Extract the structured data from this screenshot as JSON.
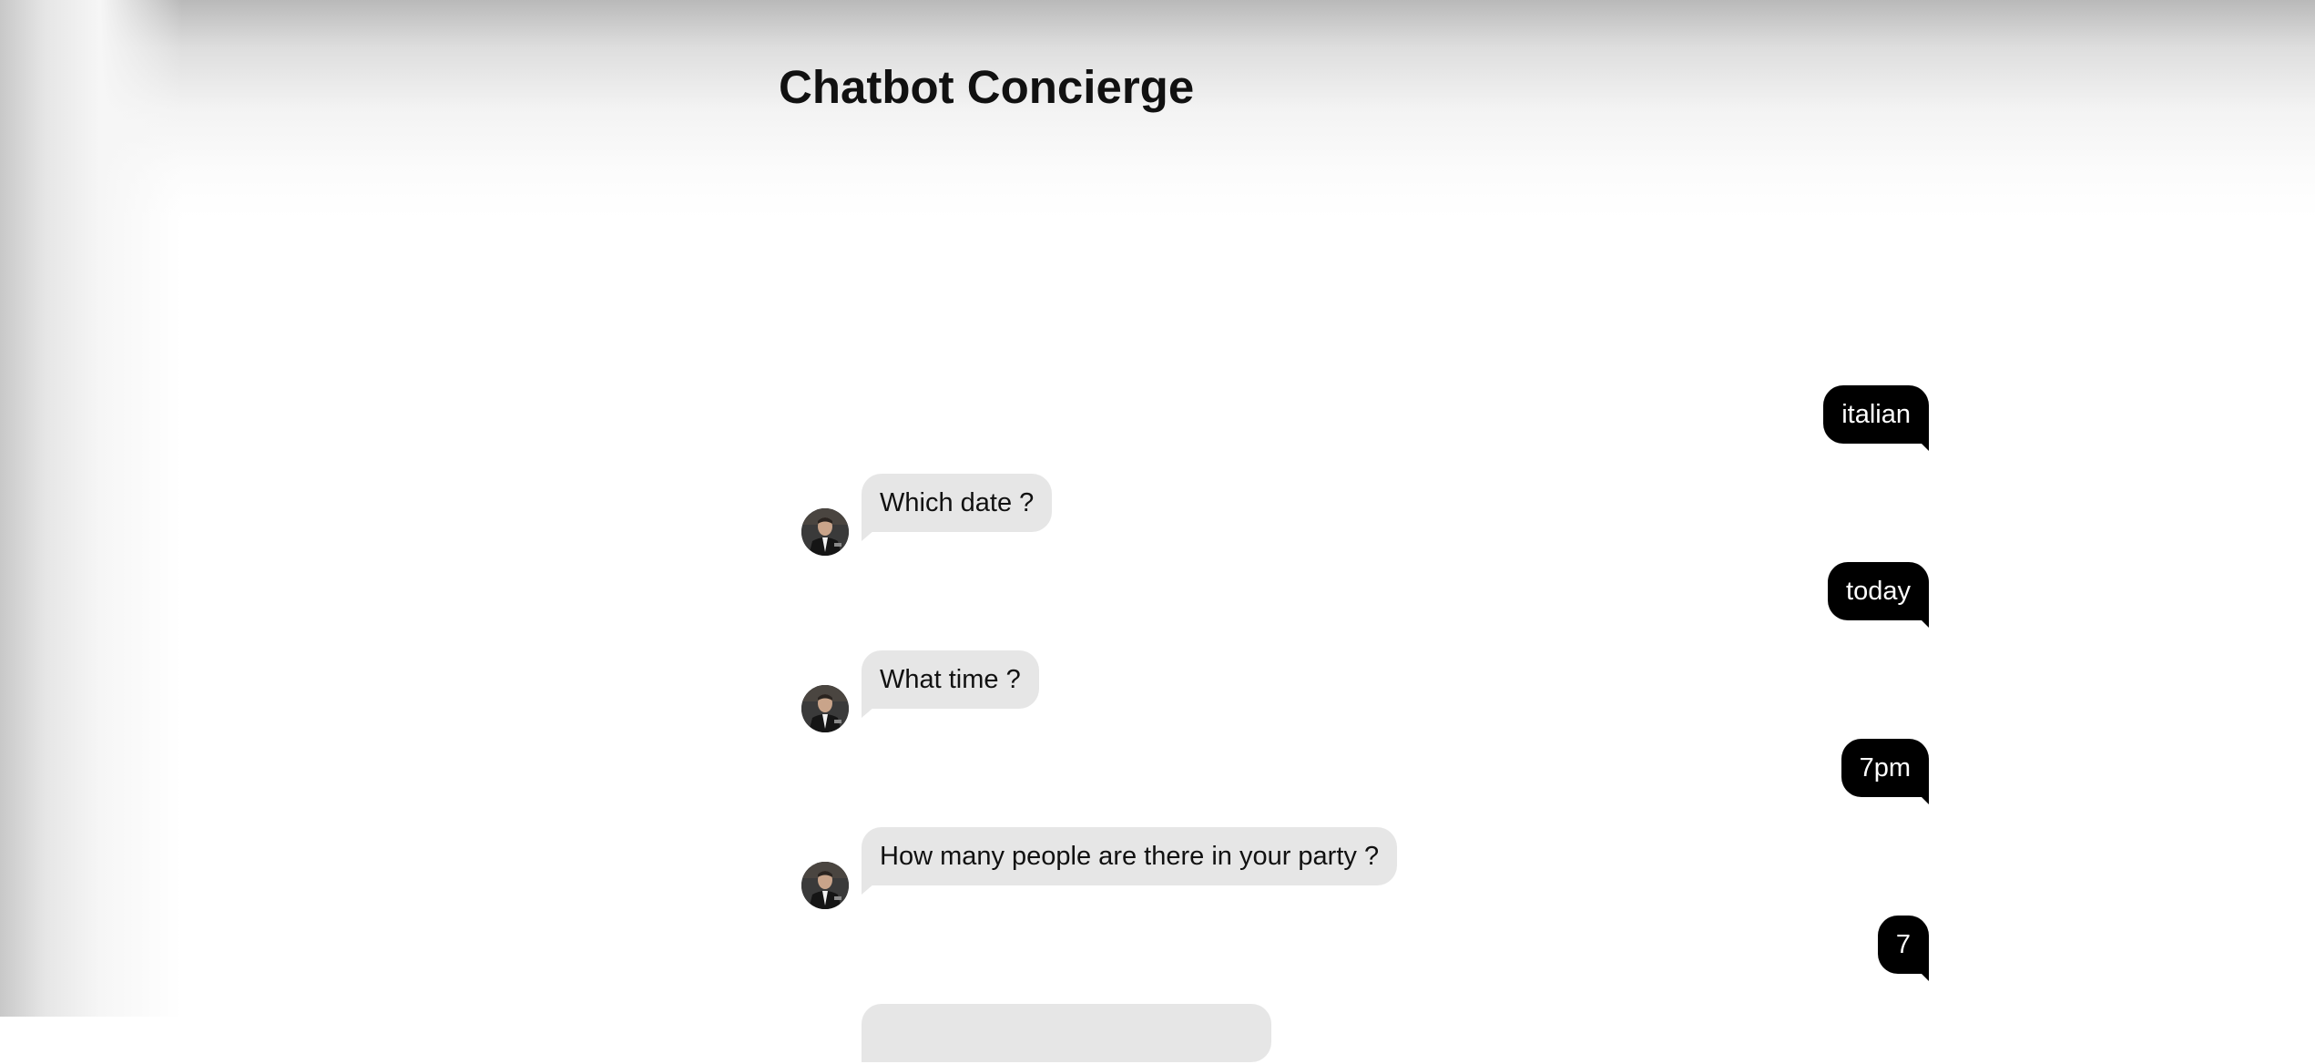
{
  "app": {
    "title": "Chatbot Concierge"
  },
  "messages": [
    {
      "sender": "user",
      "text": "italian"
    },
    {
      "sender": "bot",
      "text": "Which date ?"
    },
    {
      "sender": "user",
      "text": "today"
    },
    {
      "sender": "bot",
      "text": "What time ?"
    },
    {
      "sender": "user",
      "text": "7pm"
    },
    {
      "sender": "bot",
      "text": "How many people are there in your party ?"
    },
    {
      "sender": "user",
      "text": "7"
    },
    {
      "sender": "bot",
      "text": ""
    }
  ],
  "colors": {
    "user_bubble": "#000000",
    "user_text": "#ffffff",
    "bot_bubble": "#e6e6e6",
    "bot_text": "#111111",
    "title_text": "#111111"
  },
  "icons": {
    "bot_avatar": "bot-avatar-icon"
  }
}
